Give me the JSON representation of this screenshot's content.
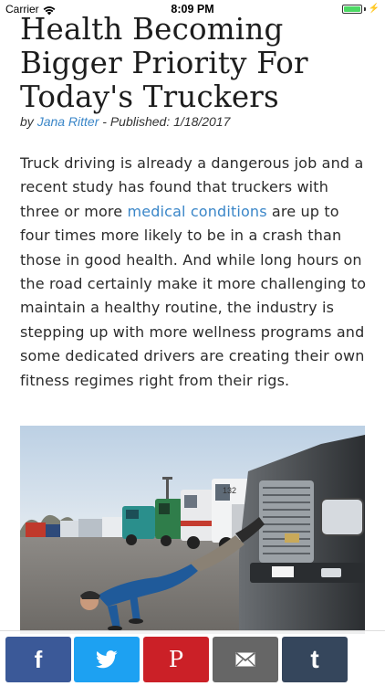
{
  "status_bar": {
    "carrier": "Carrier",
    "time": "8:09 PM",
    "battery_percent": 100,
    "battery_color": "#4cd964"
  },
  "article": {
    "title": "Health Becoming Bigger Priority For Today's Truckers",
    "byline": {
      "prefix": "by ",
      "author": "Jana Ritter",
      "published": " - Published: 1/18/2017"
    },
    "body": {
      "part1": "Truck driving is already a dangerous job and a recent study has found that truckers with three or more ",
      "link": "medical conditions",
      "part2": " are up to four times more likely to be in a crash than those in good health. And while long hours on the road certainly make it more challenging to maintain a healthy routine, the industry is stepping up with more wellness programs and some dedicated drivers are creating their own fitness regimes right from their rigs."
    },
    "link_color": "#3a86c8",
    "photo": {
      "truck_number": "132"
    }
  },
  "share_bar": {
    "buttons": [
      {
        "name": "facebook",
        "icon": "facebook-icon",
        "color": "#3b5998",
        "glyph": "f"
      },
      {
        "name": "twitter",
        "icon": "twitter-icon",
        "color": "#1da1f2"
      },
      {
        "name": "pinterest",
        "icon": "pinterest-icon",
        "color": "#cb2027",
        "glyph": "P"
      },
      {
        "name": "email",
        "icon": "email-icon",
        "color": "#666666"
      },
      {
        "name": "tumblr",
        "icon": "tumblr-icon",
        "color": "#35465c",
        "glyph": "t"
      }
    ]
  }
}
